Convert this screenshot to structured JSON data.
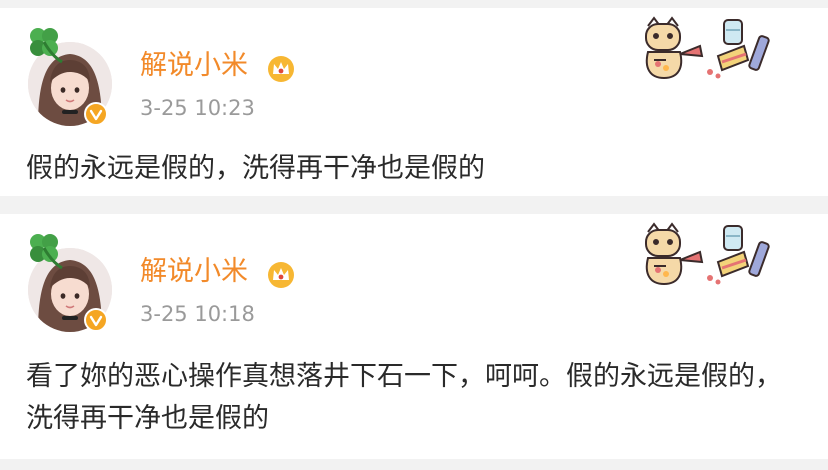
{
  "posts": [
    {
      "author": "解说小米",
      "time": "3-25 10:23",
      "text": "假的永远是假的，洗得再干净也是假的"
    },
    {
      "author": "解说小米",
      "time": "3-25 10:18",
      "text": "看了妳的恶心操作真想落井下石一下，呵呵。假的永远是假的，洗得再干净也是假的"
    }
  ],
  "icons": {
    "avatar_decoration": "clover-icon",
    "verified": "verified-badge-icon",
    "membership": "crown-icon",
    "card_sticker": "cartoon-sticker"
  },
  "colors": {
    "author_name": "#f28a2a",
    "timestamp": "#9a9a9a",
    "body_text": "#2a2a2a",
    "verified_badge": "#f5a623",
    "crown": "#f0a51c",
    "page_background": "#f2f2f2"
  }
}
